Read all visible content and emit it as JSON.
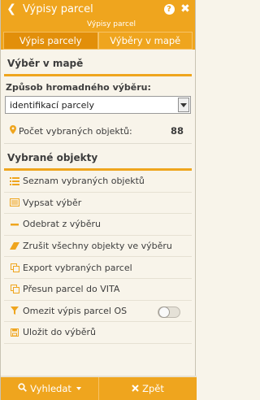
{
  "header": {
    "title": "Výpisy parcel",
    "back_icon": "chevron-left-icon",
    "help_glyph": "?",
    "close_glyph": "✖"
  },
  "subheader": "Výpisy parcel",
  "tabs": [
    {
      "label": "Výpis parcely",
      "active": true
    },
    {
      "label": "Výběry v mapě",
      "active": false
    }
  ],
  "map_selection": {
    "title": "Výběr v mapě",
    "method_label": "Způsob hromadného výběru:",
    "method_value": "identifikací parcely",
    "count_label": "Počet vybraných objektů:",
    "count_value": "88"
  },
  "selected_objects": {
    "title": "Vybrané objekty",
    "items": [
      {
        "label": "Seznam vybraných objektů",
        "icon": "list-icon"
      },
      {
        "label": "Vypsat výběr",
        "icon": "listing-icon"
      },
      {
        "label": "Odebrat z výběru",
        "icon": "minus-icon"
      },
      {
        "label": "Zrušit všechny objekty ve výběru",
        "icon": "eraser-icon"
      },
      {
        "label": "Export vybraných parcel",
        "icon": "copy-icon"
      },
      {
        "label": "Přesun parcel do VITA",
        "icon": "copy-icon"
      },
      {
        "label": "Omezit výpis parcel OS",
        "icon": "filter-icon",
        "toggle": false
      },
      {
        "label": "Uložit do výběrů",
        "icon": "save-icon"
      }
    ]
  },
  "footer": {
    "search_label": "Vyhledat",
    "back_label": "Zpět"
  },
  "colors": {
    "accent": "#efa51e",
    "accent_dark": "#e28f0a",
    "background": "#f8f4ea"
  }
}
